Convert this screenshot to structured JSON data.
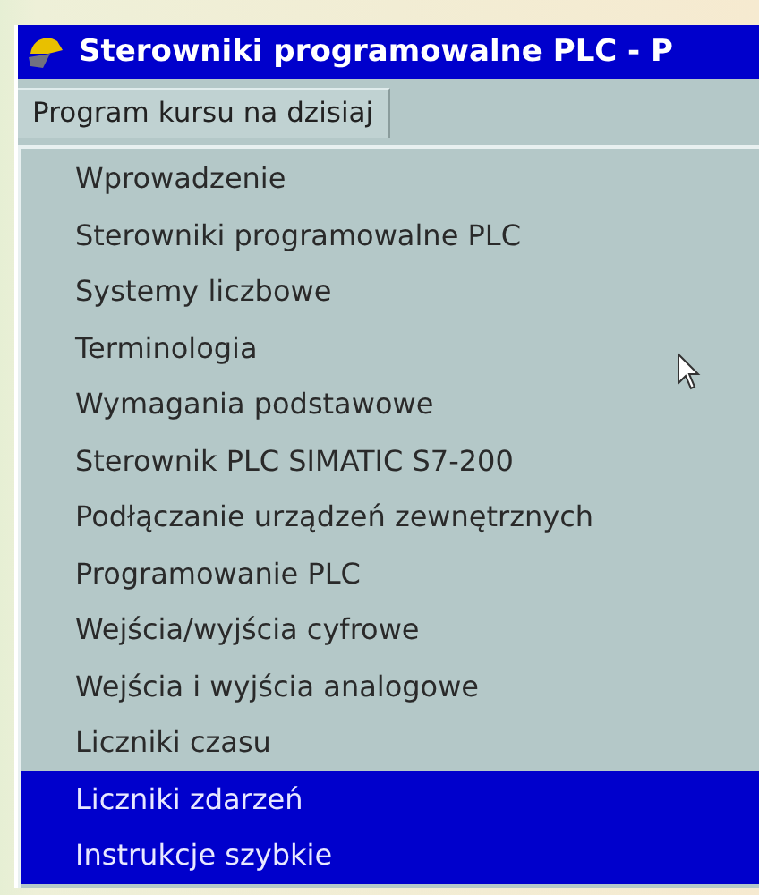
{
  "window": {
    "title": "Sterowniki programowalne PLC - P"
  },
  "tabs": [
    {
      "label": "Program kursu na dzisiaj",
      "selected": true
    }
  ],
  "list": {
    "items": [
      {
        "label": "Wprowadzenie",
        "selected": false
      },
      {
        "label": "Sterowniki programowalne PLC",
        "selected": false
      },
      {
        "label": "Systemy liczbowe",
        "selected": false
      },
      {
        "label": "Terminologia",
        "selected": false
      },
      {
        "label": "Wymagania podstawowe",
        "selected": false
      },
      {
        "label": "Sterownik PLC SIMATIC S7-200",
        "selected": false
      },
      {
        "label": "Podłączanie urządzeń zewnętrznych",
        "selected": false
      },
      {
        "label": "Programowanie PLC",
        "selected": false
      },
      {
        "label": "Wejścia/wyjścia cyfrowe",
        "selected": false
      },
      {
        "label": "Wejścia i wyjścia analogowe",
        "selected": false
      },
      {
        "label": "Liczniki czasu",
        "selected": false
      },
      {
        "label": "Liczniki zdarzeń",
        "selected": true
      },
      {
        "label": "Instrukcje szybkie",
        "selected": true
      }
    ]
  }
}
